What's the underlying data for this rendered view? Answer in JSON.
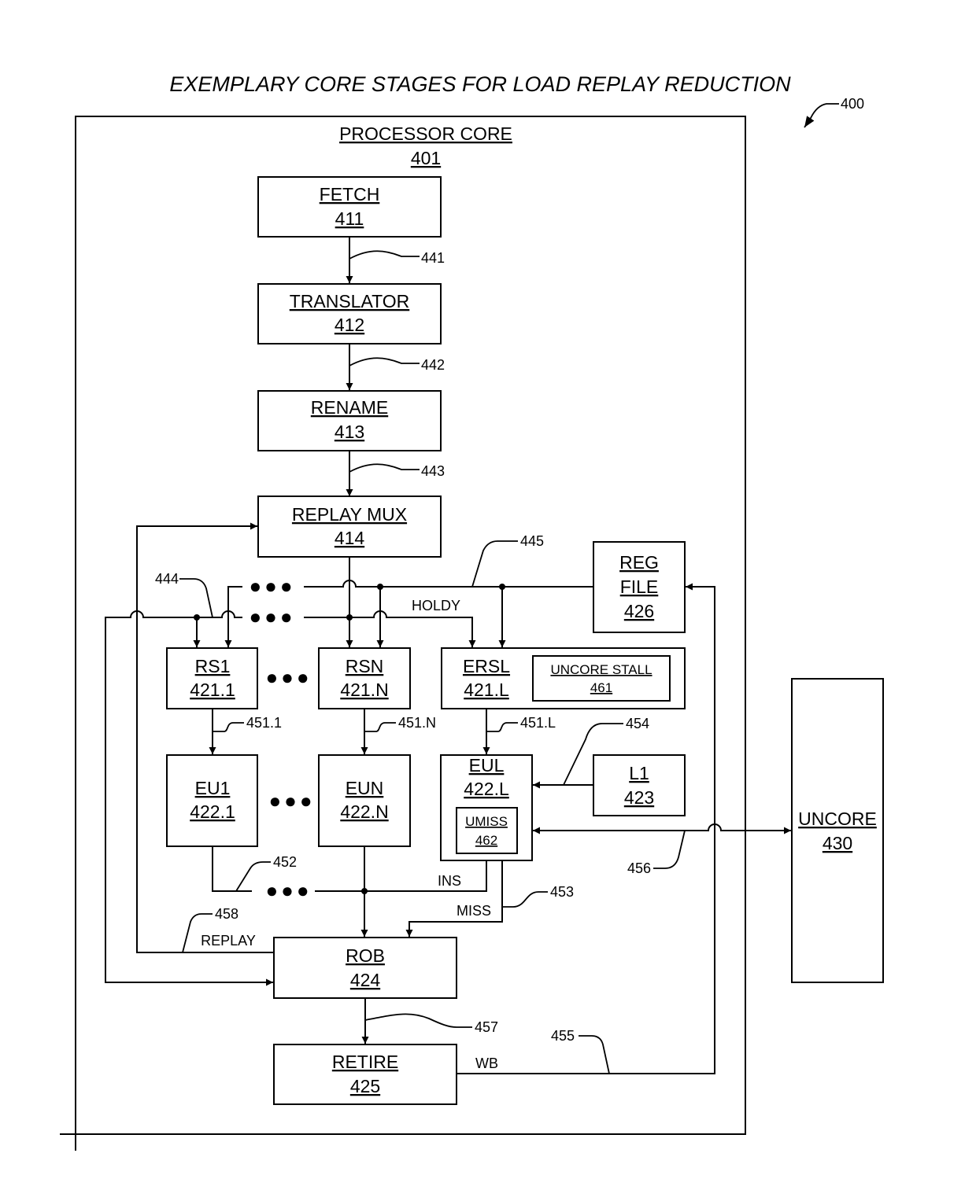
{
  "title": "EXEMPLARY CORE STAGES FOR LOAD REPLAY REDUCTION",
  "figure_ref": "400",
  "processor_core": {
    "label": "PROCESSOR CORE",
    "ref": "401"
  },
  "blocks": {
    "fetch": {
      "label": "FETCH",
      "ref": "411"
    },
    "translator": {
      "label": "TRANSLATOR",
      "ref": "412"
    },
    "rename": {
      "label": "RENAME",
      "ref": "413"
    },
    "replay_mux": {
      "label": "REPLAY MUX",
      "ref": "414"
    },
    "reg_file": {
      "label1": "REG",
      "label2": "FILE",
      "ref": "426"
    },
    "rs1": {
      "label": "RS1",
      "ref": "421.1"
    },
    "rsn": {
      "label": "RSN",
      "ref": "421.N"
    },
    "ersl": {
      "label": "ERSL",
      "ref": "421.L"
    },
    "uncore_stall": {
      "label": "UNCORE STALL",
      "ref": "461"
    },
    "eu1": {
      "label": "EU1",
      "ref": "422.1"
    },
    "eun": {
      "label": "EUN",
      "ref": "422.N"
    },
    "eul": {
      "label": "EUL",
      "ref": "422.L"
    },
    "umiss": {
      "label": "UMISS",
      "ref": "462"
    },
    "l1": {
      "label": "L1",
      "ref": "423"
    },
    "uncore": {
      "label": "UNCORE",
      "ref": "430"
    },
    "rob": {
      "label": "ROB",
      "ref": "424"
    },
    "retire": {
      "label": "RETIRE",
      "ref": "425"
    }
  },
  "connection_refs": {
    "c441": "441",
    "c442": "442",
    "c443": "443",
    "c444": "444",
    "c445": "445",
    "c451_1": "451.1",
    "c451_n": "451.N",
    "c451_l": "451.L",
    "c452": "452",
    "c453": "453",
    "c454": "454",
    "c455": "455",
    "c456": "456",
    "c457": "457",
    "c458": "458"
  },
  "signals": {
    "holdy": "HOLDY",
    "ins": "INS",
    "miss": "MISS",
    "replay": "REPLAY",
    "wb": "WB"
  },
  "ellipsis": "●●●"
}
